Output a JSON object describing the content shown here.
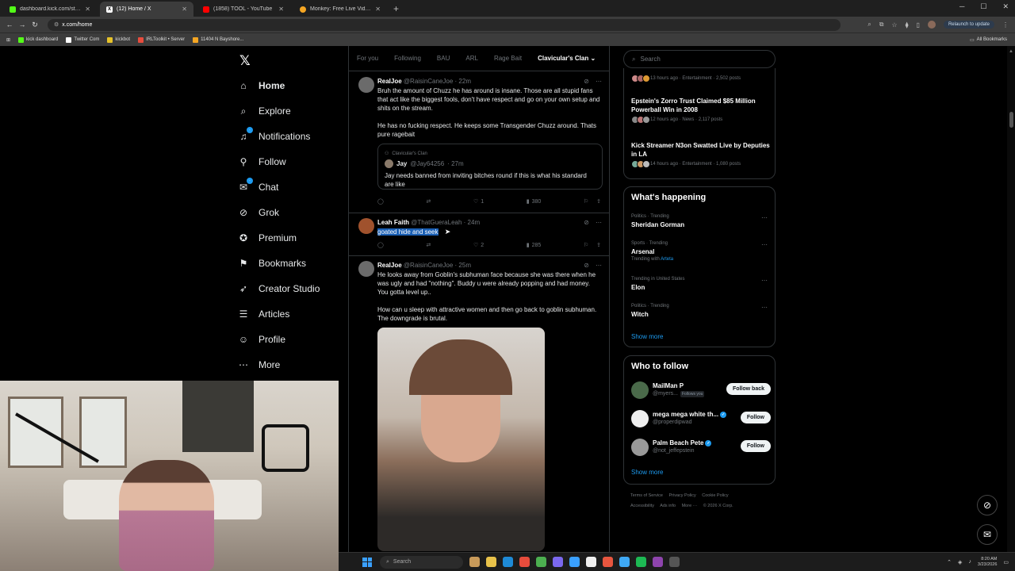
{
  "browser": {
    "tabs": [
      {
        "title": "dashboard.kick.com/stream",
        "color": "#53fc18",
        "active": false
      },
      {
        "title": "(12) Home / X",
        "color": "#ffffff",
        "active": true
      },
      {
        "title": "(1858) TOOL - YouTube",
        "color": "#ff0000",
        "active": false
      },
      {
        "title": "Monkey: Free Live Video C",
        "color": "#f5a623",
        "active": false
      }
    ],
    "url": "x.com/home",
    "relaunch_label": "Relaunch to update",
    "bookmarks": [
      "kick dashboard",
      "Twitter Com",
      "kickbot",
      "IRLToolkit • Server",
      "11404 N Bayshore..."
    ],
    "all_bookmarks": "All Bookmarks"
  },
  "nav": {
    "items": [
      {
        "label": "Home",
        "icon": "home-icon"
      },
      {
        "label": "Explore",
        "icon": "search-icon"
      },
      {
        "label": "Notifications",
        "icon": "bell-icon"
      },
      {
        "label": "Follow",
        "icon": "add-person-icon"
      },
      {
        "label": "Chat",
        "icon": "chat-icon"
      },
      {
        "label": "Grok",
        "icon": "grok-icon"
      },
      {
        "label": "Premium",
        "icon": "premium-icon"
      },
      {
        "label": "Bookmarks",
        "icon": "bookmark-icon"
      },
      {
        "label": "Creator Studio",
        "icon": "rocket-icon"
      },
      {
        "label": "Articles",
        "icon": "article-icon"
      },
      {
        "label": "Profile",
        "icon": "person-icon"
      },
      {
        "label": "More",
        "icon": "more-icon"
      }
    ]
  },
  "feed": {
    "tabs": [
      "For you",
      "Following",
      "BAU",
      "ARL",
      "Rage Bait",
      "Clavicular's Clan"
    ],
    "tweets": [
      {
        "name": "RealJoe",
        "handle": "@RaisinCaneJoe",
        "time": "· 22m",
        "text1": "Bruh the amount of Chuzz he has around is insane. Those are all stupid fans that act like the biggest fools, don't have respect and go on your own setup and shits on the stream.",
        "text2": "He has no fucking respect. He keeps some Transgender Chuzz around. Thats pure ragebait",
        "quote": {
          "context": "Clavicular's Clan",
          "name": "Jay",
          "handle": "@Jay64256",
          "time": "· 27m",
          "text": "Jay needs banned from inviting bitches round if this is what his standard are like"
        },
        "likes": "1",
        "views": "380"
      },
      {
        "name": "Leah Faith",
        "handle": "@ThatGueraLeah",
        "time": "· 24m",
        "text1": "goated hide and seek",
        "likes": "2",
        "views": "285"
      },
      {
        "name": "RealJoe",
        "handle": "@RaisinCaneJoe",
        "time": "· 25m",
        "text1": "He looks away from Goblin's subhuman face because she was there when he was ugly and had \"nothing\". Buddy u were already popping and had money. You gotta level up..",
        "text2": "How can u sleep with attractive women and then go back to goblin subhuman. The downgrade is brutal."
      }
    ]
  },
  "right": {
    "search_placeholder": "Search",
    "news": [
      {
        "title": "",
        "meta": "13 hours ago · Entertainment · 2,502 posts"
      },
      {
        "title": "Epstein's Zorro Trust Claimed $85 Million Powerball Win in 2008",
        "meta": "12 hours ago · News · 2,117 posts"
      },
      {
        "title": "Kick Streamer N3on Swatted Live by Deputies in LA",
        "meta": "14 hours ago · Entertainment · 1,080 posts"
      }
    ],
    "happening_title": "What's happening",
    "trends": [
      {
        "category": "Politics · Trending",
        "name": "Sheridan Gorman",
        "with_prefix": "",
        "with_link": ""
      },
      {
        "category": "Sports · Trending",
        "name": "Arsenal",
        "with_prefix": "Trending with",
        "with_link": "Arteta"
      },
      {
        "category": "Trending in United States",
        "name": "Elon",
        "with_prefix": "",
        "with_link": ""
      },
      {
        "category": "Politics · Trending",
        "name": "Witch",
        "with_prefix": "",
        "with_link": ""
      }
    ],
    "show_more": "Show more",
    "who_title": "Who to follow",
    "who": [
      {
        "name": "MailMan P",
        "handle": "@myers...",
        "follows_you": "Follows you",
        "button": "Follow back"
      },
      {
        "name": "mega mega white th...",
        "handle": "@properdipwad",
        "follows_you": "",
        "button": "Follow"
      },
      {
        "name": "Palm Beach Pete",
        "handle": "@not_jeffepstein",
        "follows_you": "",
        "button": "Follow"
      }
    ],
    "footer": [
      "Terms of Service",
      "Privacy Policy",
      "Cookie Policy",
      "Accessibility",
      "Ads info",
      "More ···",
      "© 2026 X Corp."
    ]
  },
  "taskbar": {
    "search": "Search",
    "time": "8:20 AM",
    "date": "3/23/2026"
  }
}
